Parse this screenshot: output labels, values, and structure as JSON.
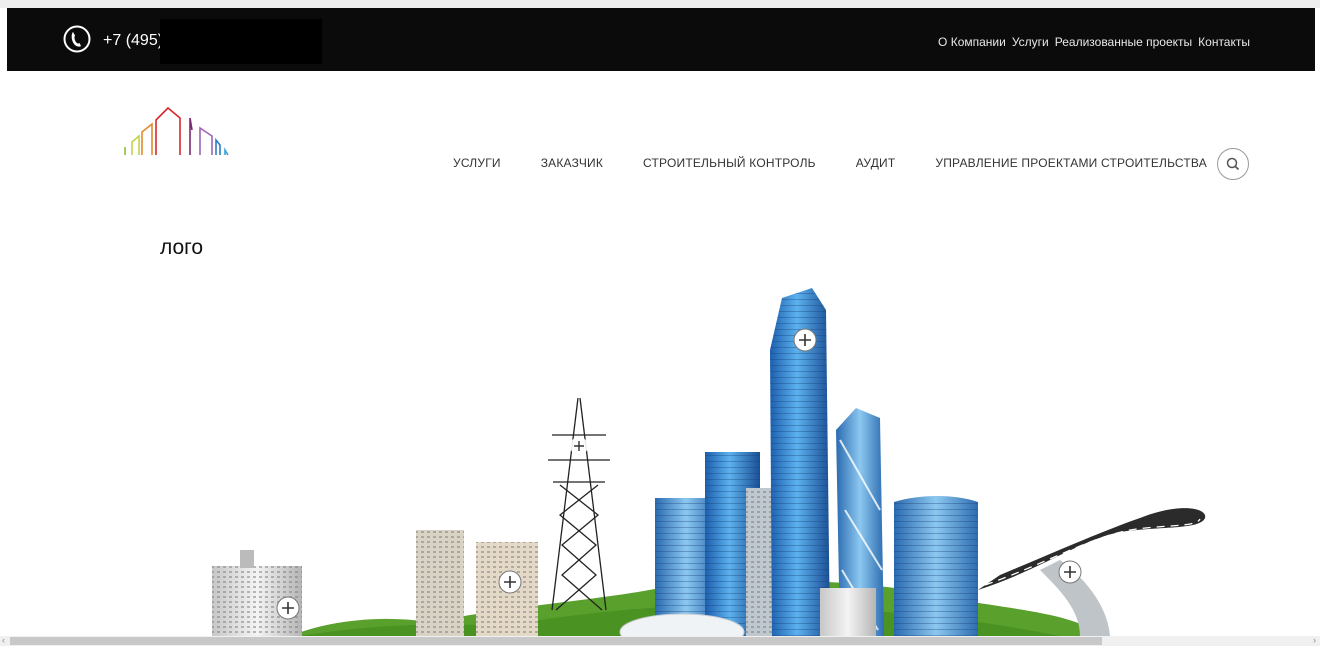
{
  "header": {
    "phone": "+7 (495)",
    "links": [
      "О Компании",
      "Услуги",
      "Реализованные проекты",
      "Контакты"
    ]
  },
  "logo": {
    "caption": "лого"
  },
  "nav": {
    "items": [
      "УСЛУГИ",
      "ЗАКАЗЧИК",
      "СТРОИТЕЛЬНЫЙ КОНТРОЛЬ",
      "АУДИТ",
      "УПРАВЛЕНИЕ ПРОЕКТАМИ СТРОИТЕЛЬСТВА"
    ]
  },
  "icons": {
    "phone": "phone-icon",
    "search": "search-icon",
    "hotspot": "plus-icon"
  },
  "colors": {
    "topbar": "#0b0b0b",
    "grass": "#5aa02c",
    "tower": "#2f7fd0"
  }
}
